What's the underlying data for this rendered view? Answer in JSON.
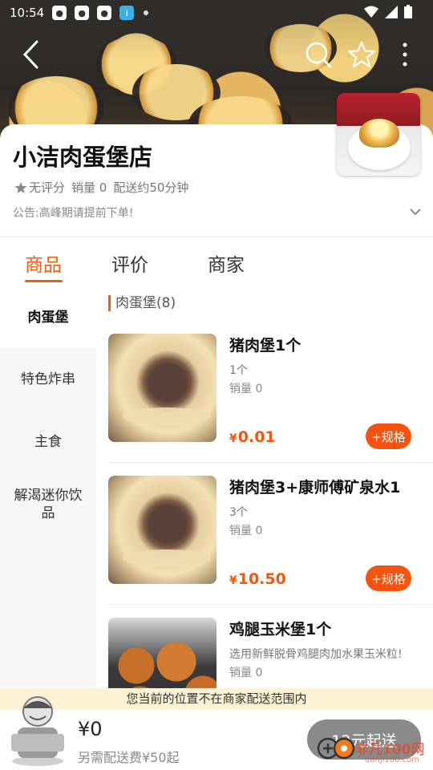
{
  "status_bar": {
    "time": "10:54"
  },
  "store": {
    "name": "小洁肉蛋堡店",
    "rating": "无评分",
    "sales": "销量 0",
    "delivery": "配送约50分钟",
    "notice": "公告:高峰期请提前下单!"
  },
  "tabs": [
    {
      "label": "商品",
      "active": true
    },
    {
      "label": "评价",
      "active": false
    },
    {
      "label": "商家",
      "active": false
    }
  ],
  "categories": [
    {
      "label": "肉蛋堡",
      "active": true
    },
    {
      "label": "特色炸串",
      "active": false
    },
    {
      "label": "主食",
      "active": false
    },
    {
      "label": "解渴迷你饮品",
      "active": false
    }
  ],
  "section_header": "肉蛋堡(8)",
  "products": [
    {
      "name": "猪肉堡1个",
      "desc": "1个",
      "sales": "销量 0",
      "currency": "¥",
      "price": "0.01",
      "spec_label": "+规格",
      "image": "pork-burger-photo"
    },
    {
      "name": "猪肉堡3+康师傅矿泉水1",
      "desc": "3个",
      "sales": "销量 0",
      "currency": "¥",
      "price": "10.50",
      "spec_label": "+规格",
      "image": "pork-burger-photo"
    },
    {
      "name": "鸡腿玉米堡1个",
      "desc": "选用新鲜脱骨鸡腿肉加水果玉米粒!",
      "sales": "销量 0",
      "image": "chicken-corn-burger-photo"
    }
  ],
  "delivery_notice": "您当前的位置不在商家配送范围内",
  "cart": {
    "total": "¥0",
    "fee_text": "另需配送费¥50起",
    "checkout_label": "12元起送"
  },
  "watermark": {
    "text": "非凡100网",
    "url": "danji100.com"
  },
  "colors": {
    "accent": "#f45b10",
    "notice_bg": "#fdf2d3",
    "checkout_disabled": "#8a8a8a"
  }
}
